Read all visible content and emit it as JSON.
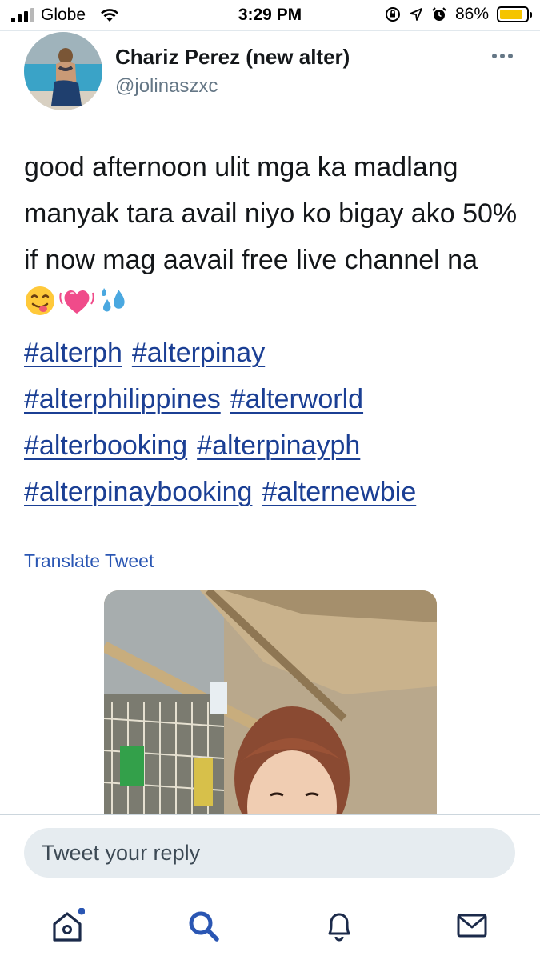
{
  "status_bar": {
    "carrier": "Globe",
    "time": "3:29 PM",
    "battery_percent": "86%",
    "battery_level": 0.86
  },
  "tweet": {
    "display_name": "Chariz Perez (new alter)",
    "handle": "@jolinaszxc",
    "text": "good afternoon ulit mga ka madlang manyak tara avail niyo ko bigay ako 50% if now mag aavail free live channel na",
    "emojis": [
      "face-savoring-food-emoji",
      "beating-heart-emoji",
      "sweat-droplets-emoji"
    ],
    "hashtags": [
      "#alterph",
      "#alterpinay",
      "#alterphilippines",
      "#alterworld",
      "#alterbooking",
      "#alterpinayph",
      "#alterpinaybooking",
      "#alternewbie"
    ],
    "translate_label": "Translate Tweet"
  },
  "reply": {
    "placeholder": "Tweet your reply"
  },
  "tab_bar": {
    "items": [
      "home-icon",
      "search-icon",
      "notifications-icon",
      "messages-icon"
    ],
    "active": "search-icon",
    "home_has_new_dot": true
  },
  "colors": {
    "link": "#1b3f94",
    "accent": "#2a56b3",
    "text": "#14171a",
    "muted": "#657786",
    "input_bg": "#e6ecf0",
    "battery": "#f5c400"
  }
}
